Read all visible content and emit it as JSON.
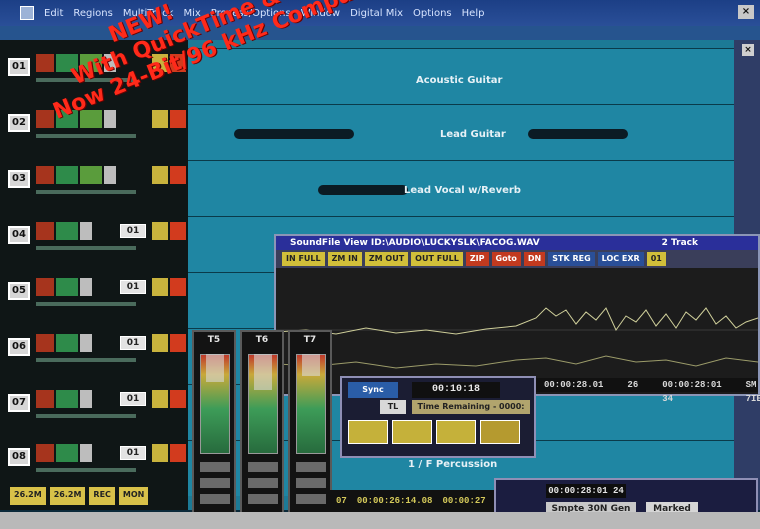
{
  "menubar": {
    "items": [
      "Edit",
      "Regions",
      "MultiTrack",
      "Mix",
      "Process/Options",
      "Window",
      "Digital Mix",
      "Options",
      "Help"
    ]
  },
  "tracks": [
    {
      "num": "01",
      "channel": "",
      "label": "Acoustic Guitar"
    },
    {
      "num": "02",
      "channel": "",
      "label": "Lead Guitar"
    },
    {
      "num": "03",
      "channel": "",
      "label": "Lead Vocal w/Reverb"
    },
    {
      "num": "04",
      "channel": "01",
      "label": ""
    },
    {
      "num": "05",
      "channel": "01",
      "label": ""
    },
    {
      "num": "06",
      "channel": "01",
      "label": ""
    },
    {
      "num": "07",
      "channel": "01",
      "label": ""
    },
    {
      "num": "08",
      "channel": "01",
      "label": ""
    }
  ],
  "promo_lines": [
    "NEW!",
    "With QuickTime & Summary",
    "Now 24-Bit/96 kHz Compatible!"
  ],
  "soundfile": {
    "title": "SoundFile View ID:\\AUDIO\\LUCKYSLK\\FACOG.WAV",
    "title_right": "2 Track",
    "tools": [
      "IN FULL",
      "ZM IN",
      "ZM OUT",
      "OUT FULL",
      "ZIP",
      "Goto",
      "DN",
      "STK REG",
      "LOC EXR",
      "01"
    ],
    "time_a": "00:00:28.01",
    "time_b": "26",
    "time_c": "00:00:28:01 34",
    "time_right": "SM 7IE"
  },
  "meters": [
    {
      "label": "T5"
    },
    {
      "label": "T6"
    },
    {
      "label": "T7"
    }
  ],
  "transport": {
    "timecode": "00:10:18",
    "remaining": "Time Remaining - 0000:",
    "sync_label": "Sync",
    "tl_label": "TL",
    "buttons": [
      "1",
      "2",
      "3",
      "4"
    ]
  },
  "bottom_times": [
    "07",
    "00:00:26:14.08",
    "00:00:27"
  ],
  "smpte": {
    "timecode": "00:00:28:01 24",
    "label": "Smpte 30N Gen",
    "marked": "Marked"
  },
  "lane_bottom_label": "1 / F Percussion",
  "mix_buttons": [
    "26.2M",
    "26.2M",
    "REC",
    "MON"
  ]
}
